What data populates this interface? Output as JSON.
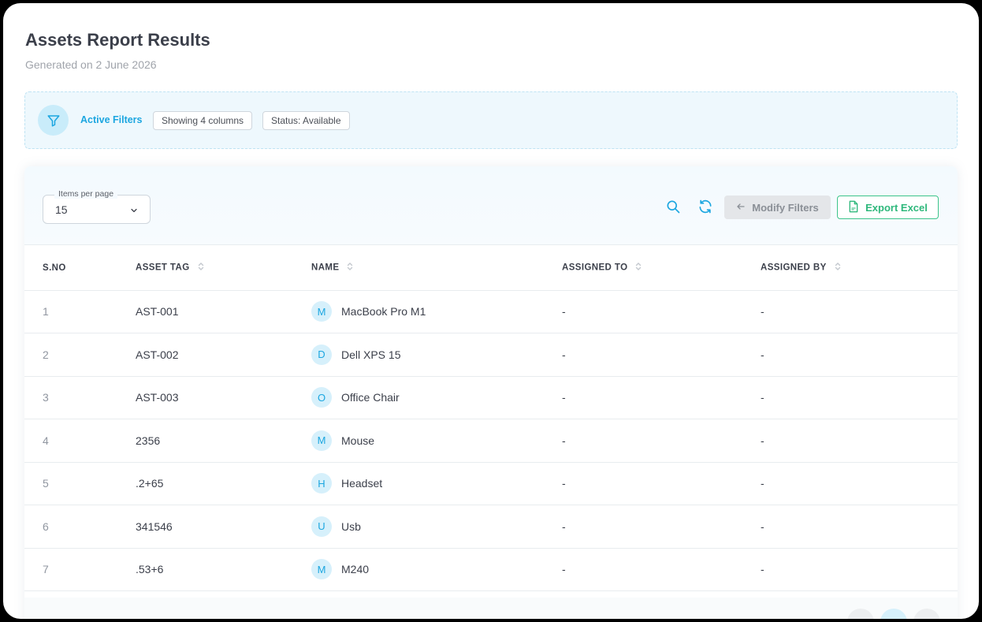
{
  "page": {
    "title": "Assets Report Results",
    "subtitle": "Generated on 2 June 2026"
  },
  "filters": {
    "label": "Active Filters",
    "chips": [
      "Showing 4 columns",
      "Status: Available"
    ],
    "icon": "filter-icon"
  },
  "toolbar": {
    "per_page_label": "Items per page",
    "per_page_value": "15",
    "search_icon": "search-icon",
    "refresh_icon": "refresh-icon",
    "modify_label": "Modify Filters",
    "export_label": "Export Excel"
  },
  "table": {
    "columns": [
      "S.NO",
      "ASSET TAG",
      "NAME",
      "ASSIGNED TO",
      "ASSIGNED BY"
    ],
    "rows": [
      {
        "sno": "1",
        "tag": "AST-001",
        "initial": "M",
        "name": "MacBook Pro M1",
        "assigned_to": "-",
        "assigned_by": "-"
      },
      {
        "sno": "2",
        "tag": "AST-002",
        "initial": "D",
        "name": "Dell XPS 15",
        "assigned_to": "-",
        "assigned_by": "-"
      },
      {
        "sno": "3",
        "tag": "AST-003",
        "initial": "O",
        "name": "Office Chair",
        "assigned_to": "-",
        "assigned_by": "-"
      },
      {
        "sno": "4",
        "tag": "2356",
        "initial": "M",
        "name": "Mouse",
        "assigned_to": "-",
        "assigned_by": "-"
      },
      {
        "sno": "5",
        "tag": ".2+65",
        "initial": "H",
        "name": "Headset",
        "assigned_to": "-",
        "assigned_by": "-"
      },
      {
        "sno": "6",
        "tag": "341546",
        "initial": "U",
        "name": "Usb",
        "assigned_to": "-",
        "assigned_by": "-"
      },
      {
        "sno": "7",
        "tag": ".53+6",
        "initial": "M",
        "name": "M240",
        "assigned_to": "-",
        "assigned_by": "-"
      }
    ]
  },
  "colors": {
    "accent": "#1ba6e0",
    "export_green": "#2fb87c",
    "filter_bg": "#eef8fd"
  }
}
